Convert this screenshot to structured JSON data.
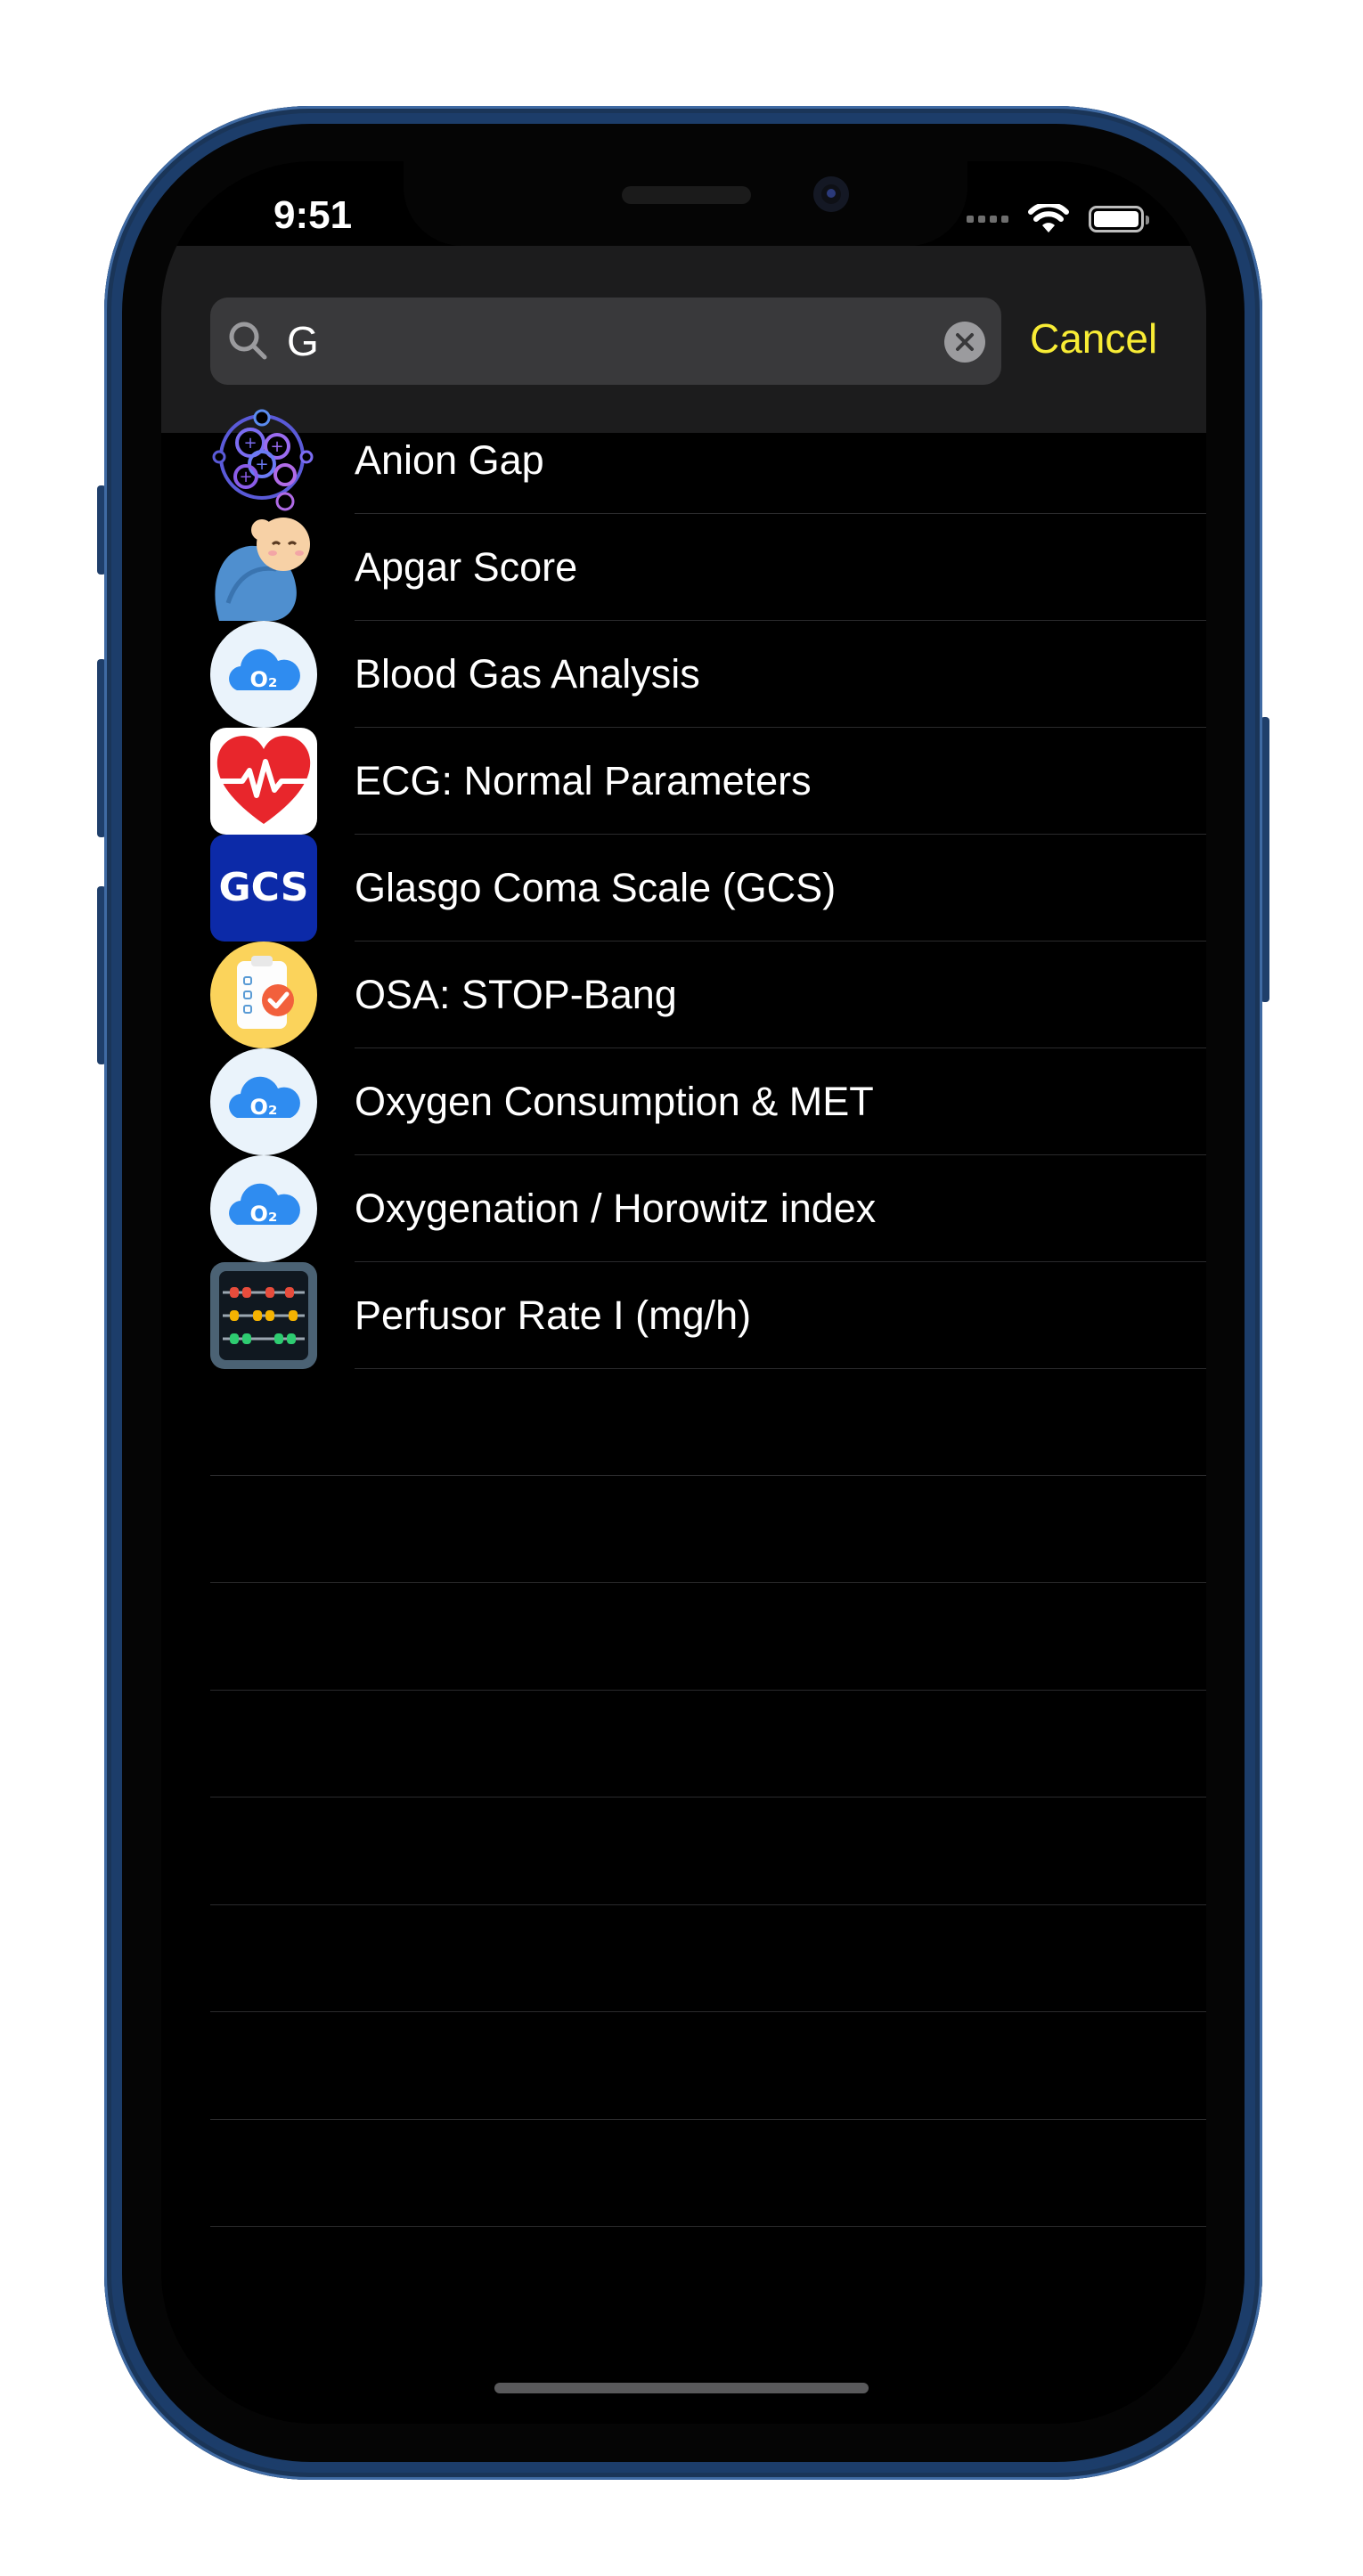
{
  "status_bar": {
    "time": "9:51"
  },
  "search": {
    "value": "G",
    "cancel_label": "Cancel"
  },
  "results": [
    {
      "label": "Anion Gap",
      "icon": "anion-gap-icon"
    },
    {
      "label": "Apgar Score",
      "icon": "baby-icon"
    },
    {
      "label": "Blood Gas Analysis",
      "icon": "o2-cloud-icon"
    },
    {
      "label": "ECG: Normal Parameters",
      "icon": "heart-ecg-icon"
    },
    {
      "label": "Glasgo Coma Scale (GCS)",
      "icon": "gcs-icon"
    },
    {
      "label": "OSA: STOP-Bang",
      "icon": "checklist-icon"
    },
    {
      "label": "Oxygen Consumption & MET",
      "icon": "o2-cloud-icon"
    },
    {
      "label": "Oxygenation / Horowitz index",
      "icon": "o2-cloud-icon"
    },
    {
      "label": "Perfusor Rate I (mg/h)",
      "icon": "abacus-icon"
    }
  ],
  "colors": {
    "accent": "#f8ec35",
    "frame": "#1c3d6a",
    "background": "#000000"
  }
}
